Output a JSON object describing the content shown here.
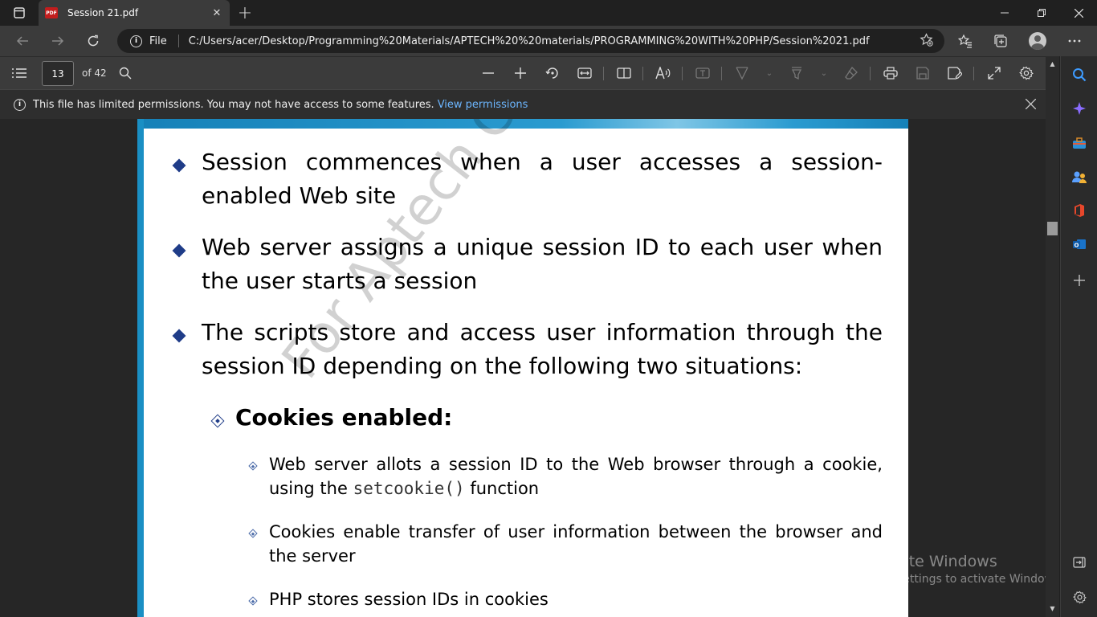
{
  "browser": {
    "tab_title": "Session 21.pdf",
    "tab_close": "✕",
    "new_tab": "+",
    "url_scheme": "File",
    "url": "C:/Users/acer/Desktop/Programming%20Materials/APTECH%20%20materials/PROGRAMMING%20WITH%20PHP/Session%2021.pdf"
  },
  "pdf_toolbar": {
    "page_number": "13",
    "page_total": "of 42"
  },
  "notice": {
    "text": "This file has limited permissions. You may not have access to some features.",
    "link": "View permissions"
  },
  "document": {
    "bullets": [
      "Session commences when a user accesses a session-enabled Web site",
      "Web server assigns a unique session ID to each user when the user starts a session",
      "The scripts store and access user information through the session ID depending on the following two situations:"
    ],
    "sub_heading": "Cookies enabled:",
    "sub_bullets": {
      "one_before": "Web server allots a session ID to the Web browser through a cookie, using the",
      "one_code": "setcookie()",
      "one_after": "function",
      "two": "Cookies enable transfer of user information between the browser and the server",
      "three": "PHP stores session IDs in cookies"
    },
    "watermark": "For Aptech Center Use Only"
  },
  "os_overlay": {
    "line1": "Activate Windows",
    "line2": "Go to Settings to activate Windows."
  },
  "colors": {
    "accent_link": "#6cb6ff",
    "bullet_blue": "#1f3c88",
    "page_band": "#1a8fc4"
  }
}
